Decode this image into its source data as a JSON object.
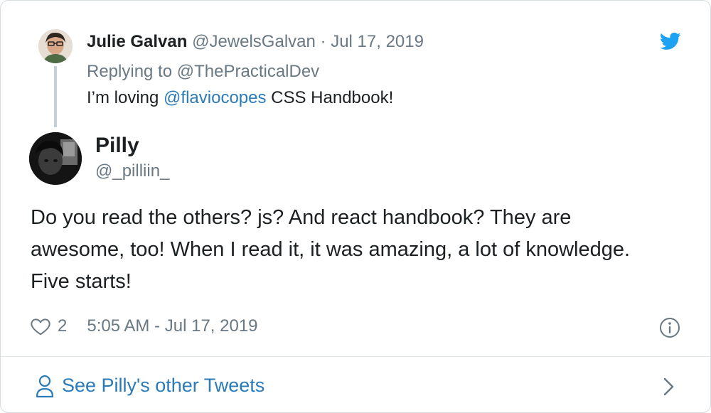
{
  "parent_tweet": {
    "author_name": "Julie Galvan",
    "author_handle": "@JewelsGalvan",
    "separator": "·",
    "date": "Jul 17, 2019",
    "replying_to_label": "Replying to",
    "replying_to_handle": "@ThePracticalDev",
    "text_before": "I’m loving",
    "text_mention": "@flaviocopes",
    "text_after": "CSS Handbook!"
  },
  "tweet": {
    "author_name": "Pilly",
    "author_handle": "@_pilliin_",
    "text": "Do you read the others? js? And react handbook? They are awesome, too! When I read it, it was amazing, a lot of knowledge. Five starts!",
    "like_count": "2",
    "timestamp": "5:05 AM - Jul 17, 2019"
  },
  "footer": {
    "see_more_label": "See Pilly's other Tweets"
  },
  "icons": {
    "brand": "twitter-bird-icon",
    "like": "heart-icon",
    "info": "info-icon",
    "profile": "person-icon",
    "next": "chevron-right-icon"
  },
  "colors": {
    "brand": "#1da1f2",
    "link": "#2b7bb9",
    "muted_text": "#697882",
    "body_text": "#1c2022",
    "border": "#d7dce0"
  }
}
